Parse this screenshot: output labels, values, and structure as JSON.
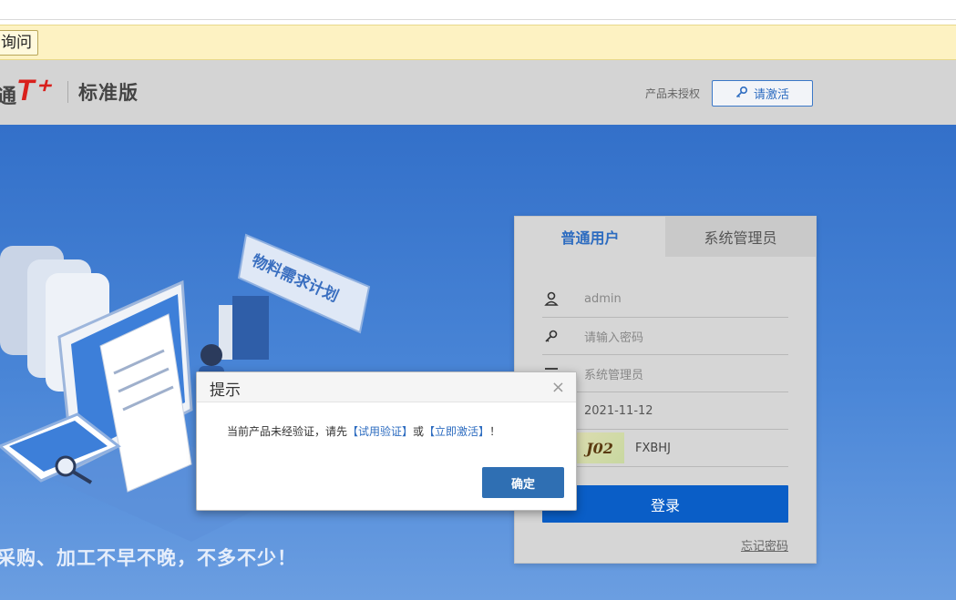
{
  "browser": {
    "ask_button": "询问"
  },
  "header": {
    "logo_char": "通",
    "logo_t": "T⁺",
    "edition": "标准版",
    "unlicensed": "产品未授权",
    "activate_label": "请激活"
  },
  "hero": {
    "slogan": "采购、加工不早不晚，不多不少！",
    "banner_text": "物料需求计划"
  },
  "login": {
    "tabs": [
      {
        "label": "普通用户",
        "active": true
      },
      {
        "label": "系统管理员",
        "active": false
      }
    ],
    "username": "admin",
    "password_placeholder": "请输入密码",
    "account": "系统管理员",
    "date": "2021-11-12",
    "captcha_image_text": "J02",
    "captcha_value": "FXBHJ",
    "login_button": "登录",
    "forgot": "忘记密码"
  },
  "modal": {
    "title": "提示",
    "close": "×",
    "msg_prefix": "当前产品未经验证，请先",
    "link_trial": "【试用验证】",
    "msg_or": "或",
    "link_activate": "【立即激活】",
    "msg_suffix": "！",
    "ok_button": "确定"
  },
  "colors": {
    "accent": "#2d6cc0",
    "login_button": "#0a5ec7",
    "brand_red": "#d9201c",
    "hero_blue": "#3370c9"
  }
}
